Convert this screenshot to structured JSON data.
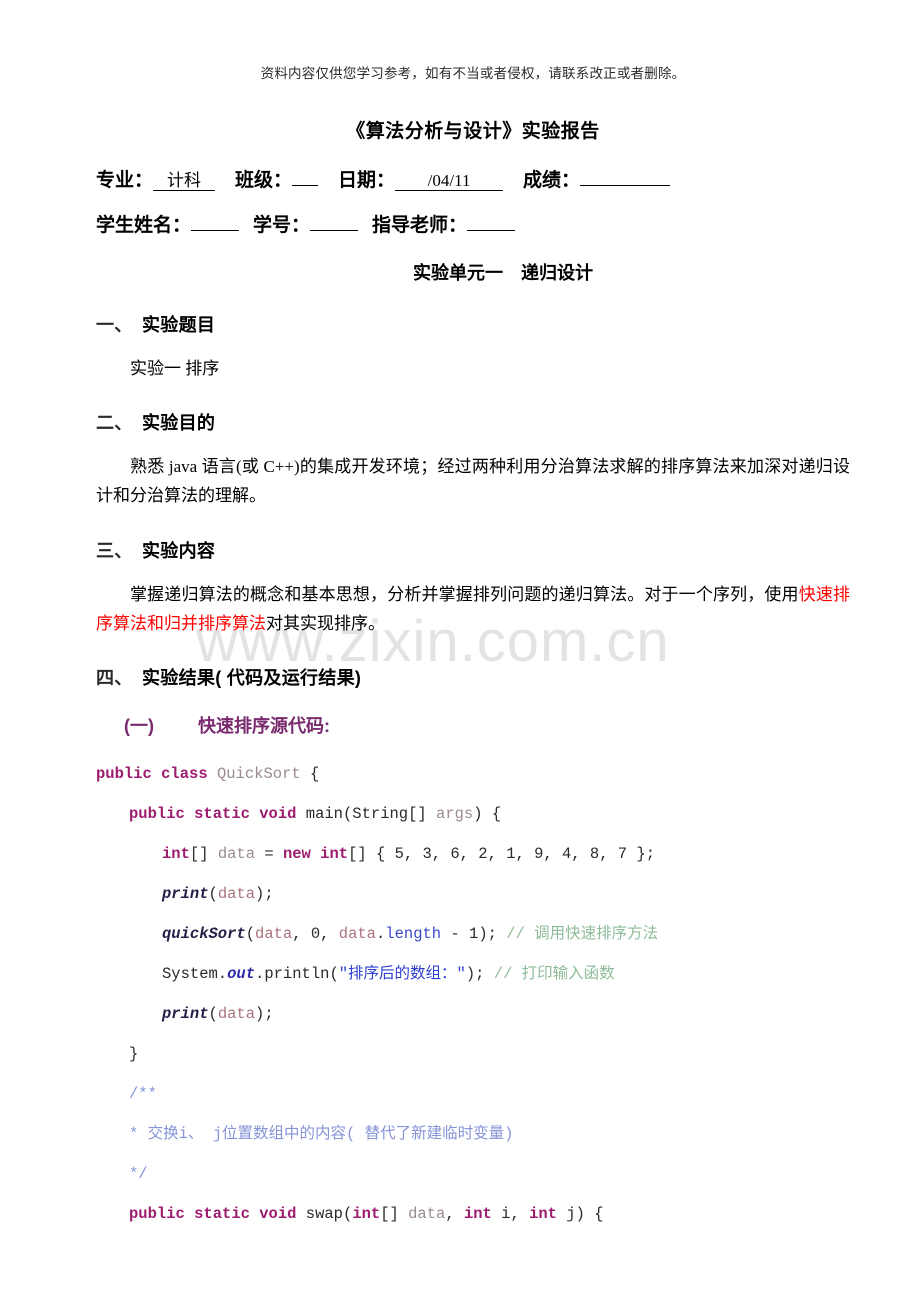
{
  "document": {
    "disclaimer": "资料内容仅供您学习参考，如有不当或者侵权，请联系改正或者删除。",
    "title": "《算法分析与设计》实验报告",
    "watermark": "www.zixin.com.cn"
  },
  "meta": {
    "major_label": "专业：",
    "major_value": "计科",
    "class_label": "班级：",
    "class_value": "",
    "date_label": "日期：",
    "date_value": "/04/11",
    "score_label": "成绩：",
    "score_value": "",
    "student_label": "学生姓名：",
    "student_value": "",
    "sid_label": "学号：",
    "sid_value": "",
    "teacher_label": "指导老师：",
    "teacher_value": ""
  },
  "unit_heading": "实验单元一　递归设计",
  "sections": {
    "s1": {
      "num": "一、",
      "title": "实验题目",
      "body": "实验一 排序"
    },
    "s2": {
      "num": "二、",
      "title": "实验目的",
      "body": "熟悉 java 语言(或 C++)的集成开发环境；经过两种利用分治算法求解的排序算法来加深对递归设计和分治算法的理解。"
    },
    "s3": {
      "num": "三、",
      "title": "实验内容",
      "body_part1": "掌握递归算法的概念和基本思想，分析并掌握排列问题的递归算法。对于一个序列，使用",
      "body_highlight": "快速排序算法和归并排序算法",
      "body_part2": "对其实现排序。"
    },
    "s4": {
      "num": "四、",
      "title": "实验结果( 代码及运行结果)",
      "subsection_num": "(一)",
      "subsection_title": "快速排序源代码:"
    }
  },
  "code": {
    "line1": {
      "kw1": "public",
      "kw2": "class",
      "name": "QuickSort",
      "brace": "{"
    },
    "line2": {
      "kw1": "public",
      "kw2": "static",
      "kw3": "void",
      "name": "main",
      "open": "(String[] ",
      "arg": "args",
      "close": ") {"
    },
    "line3": {
      "kw1": "int",
      "brackets": "[] ",
      "var": "data",
      "eq": " = ",
      "kw2": "new",
      "kw3": "int",
      "arr": "[] { 5, 3, 6, 2, 1, 9, 4, 8, 7 };"
    },
    "line4": {
      "method": "print",
      "rest": "(",
      "var": "data",
      "tail": ");"
    },
    "line5": {
      "method": "quickSort",
      "open": "(",
      "var1": "data",
      "mid": ", 0, ",
      "var2": "data",
      "dot": ".",
      "field": "length",
      "tail": " - 1); ",
      "comment": "// 调用快速排序方法"
    },
    "line6": {
      "sys": "System.",
      "out": "out",
      "println": ".println(",
      "str": "\"排序后的数组：\"",
      "tail": "); ",
      "comment": "// 打印输入函数"
    },
    "line7": {
      "method": "print",
      "rest": "(",
      "var": "data",
      "tail": ");"
    },
    "line8": {
      "brace": "}"
    },
    "line9": {
      "doc": "/**"
    },
    "line10": {
      "doc": "* 交换i、 j位置数组中的内容( 替代了新建临时变量)"
    },
    "line11": {
      "doc": "*/"
    },
    "line12": {
      "kw1": "public",
      "kw2": "static",
      "kw3": "void",
      "name": "swap",
      "open": "(",
      "kw4": "int",
      "br": "[] ",
      "var": "data",
      "c1": ", ",
      "kw5": "int",
      "i": " i, ",
      "kw6": "int",
      "j": " j) {"
    }
  }
}
